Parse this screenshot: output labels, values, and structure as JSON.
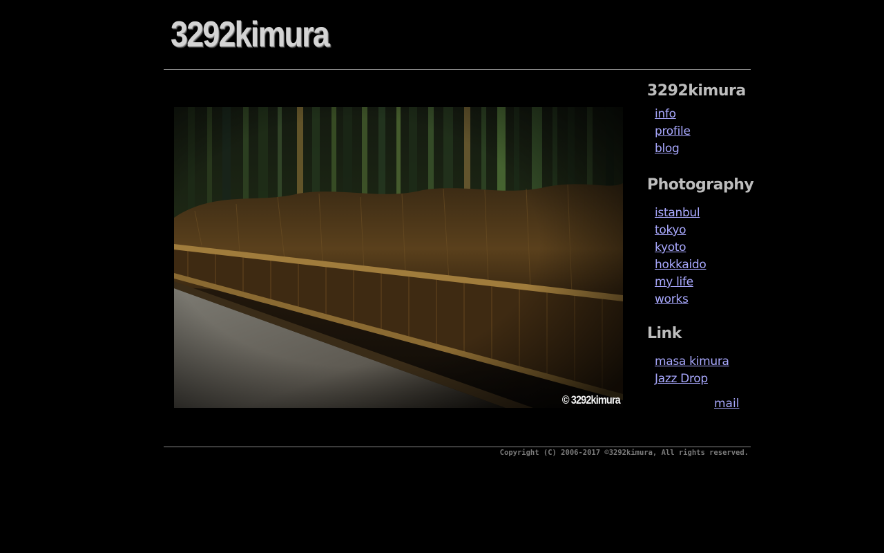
{
  "header": {
    "logo_text": "3292kimura"
  },
  "photo": {
    "watermark": "© 3292kimura",
    "subject": "bamboo fence"
  },
  "sidebar": {
    "sections": [
      {
        "title": "3292kimura",
        "links": [
          "info",
          "profile",
          "blog"
        ]
      },
      {
        "title": "Photography",
        "links": [
          "istanbul",
          "tokyo",
          "kyoto",
          "hokkaido",
          "my life",
          "works"
        ]
      },
      {
        "title": "Link",
        "links": [
          "masa kimura",
          "Jazz Drop"
        ]
      }
    ],
    "mail_label": "mail"
  },
  "footer": {
    "copyright": "Copyright (C) 2006-2017 ©3292kimura, All rights reserved."
  },
  "colors": {
    "background": "#000000",
    "link": "#a9a9ff",
    "heading": "#bdbdbd",
    "rule": "#8a8a8a",
    "copyright": "#7a7a7a"
  }
}
